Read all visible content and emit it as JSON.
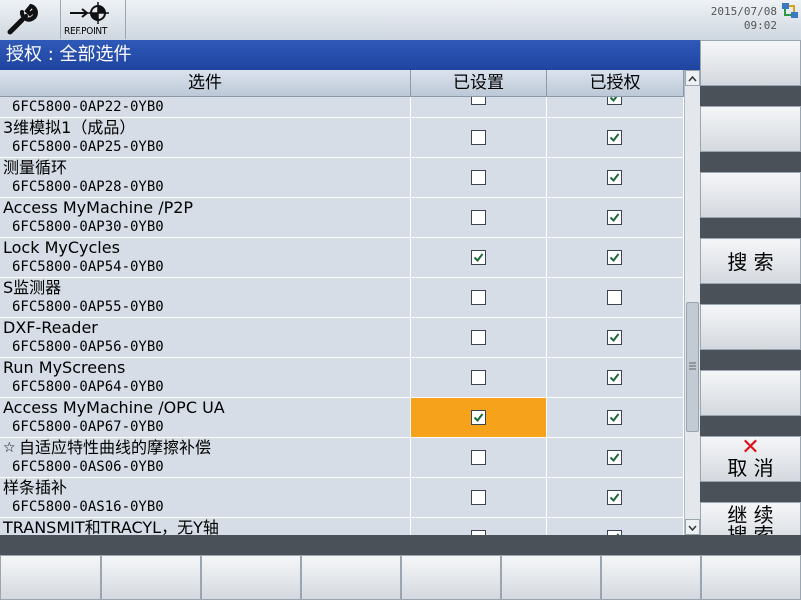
{
  "topbar": {
    "ref_label": "REF.POINT",
    "date": "2015/07/08",
    "time": "09:02"
  },
  "title": "授权 : 全部选件",
  "table": {
    "headers": [
      "选件",
      "已设置",
      "已授权"
    ],
    "rows": [
      {
        "name": "",
        "code": "6FC5800-0AP22-0YB0",
        "set": false,
        "licensed": true
      },
      {
        "name": "3维模拟1（成品）",
        "code": "6FC5800-0AP25-0YB0",
        "set": false,
        "licensed": true
      },
      {
        "name": "测量循环",
        "code": "6FC5800-0AP28-0YB0",
        "set": false,
        "licensed": true
      },
      {
        "name": "Access MyMachine /P2P",
        "code": "6FC5800-0AP30-0YB0",
        "set": false,
        "licensed": true
      },
      {
        "name": "Lock MyCycles",
        "code": "6FC5800-0AP54-0YB0",
        "set": true,
        "licensed": true
      },
      {
        "name": "S监测器",
        "code": "6FC5800-0AP55-0YB0",
        "set": false,
        "licensed": false
      },
      {
        "name": "DXF-Reader",
        "code": "6FC5800-0AP56-0YB0",
        "set": false,
        "licensed": true
      },
      {
        "name": "Run MyScreens",
        "code": "6FC5800-0AP64-0YB0",
        "set": false,
        "licensed": true
      },
      {
        "name": "Access MyMachine /OPC UA",
        "code": "6FC5800-0AP67-0YB0",
        "set": true,
        "licensed": true,
        "selected": true
      },
      {
        "name": "自适应特性曲线的摩擦补偿",
        "code": "6FC5800-0AS06-0YB0",
        "set": false,
        "licensed": true,
        "star": true
      },
      {
        "name": "样条插补",
        "code": "6FC5800-0AS16-0YB0",
        "set": false,
        "licensed": true
      },
      {
        "name": "TRANSMIT和TRACYL，无Y轴",
        "code": "",
        "set": false,
        "licensed": true
      }
    ]
  },
  "softkeys": {
    "search": "搜 索",
    "cancel": "取 消",
    "continue_line1": "继 续",
    "continue_line2": "搜 索"
  },
  "colors": {
    "title_bg": "#1f44a0",
    "selected_cell": "#f7a21b",
    "check": "#1a6a3a",
    "cancel_x": "#e0101a"
  }
}
